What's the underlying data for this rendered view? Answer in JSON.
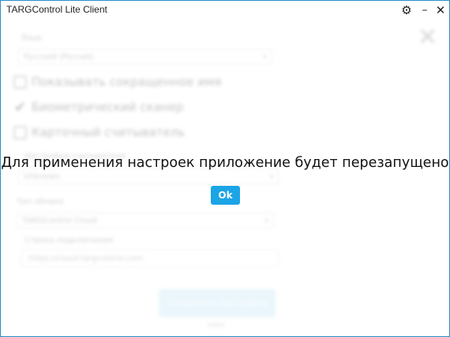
{
  "window": {
    "title": "TARGControl Lite Client",
    "controls": {
      "settings": "⚙",
      "minimize": "–",
      "close": "✕"
    }
  },
  "settings_form": {
    "close_glyph": "✕",
    "language_label": "Язык",
    "language_value": "Русский (Россия)",
    "checkboxes": [
      {
        "label": "Показывать сокращенное имя",
        "checked": false
      },
      {
        "label": "Биометрический сканер",
        "checked": true
      },
      {
        "label": "Карточный считыватель",
        "checked": false
      }
    ],
    "reader_label": "Настройки считывателя",
    "reader_value": "Unknown",
    "cloud_type_label": "Тип облака",
    "cloud_type_value": "TARGControl Cloud",
    "connection_label": "Строка подключения",
    "connection_value": "https://cloud.targcontrol.com",
    "save_label": "Сохранить настройки",
    "footer": "save"
  },
  "dialog": {
    "message": "Для применения настроек приложение будет перезапущено",
    "ok_label": "Ok",
    "accent": "#1ba4e6"
  }
}
